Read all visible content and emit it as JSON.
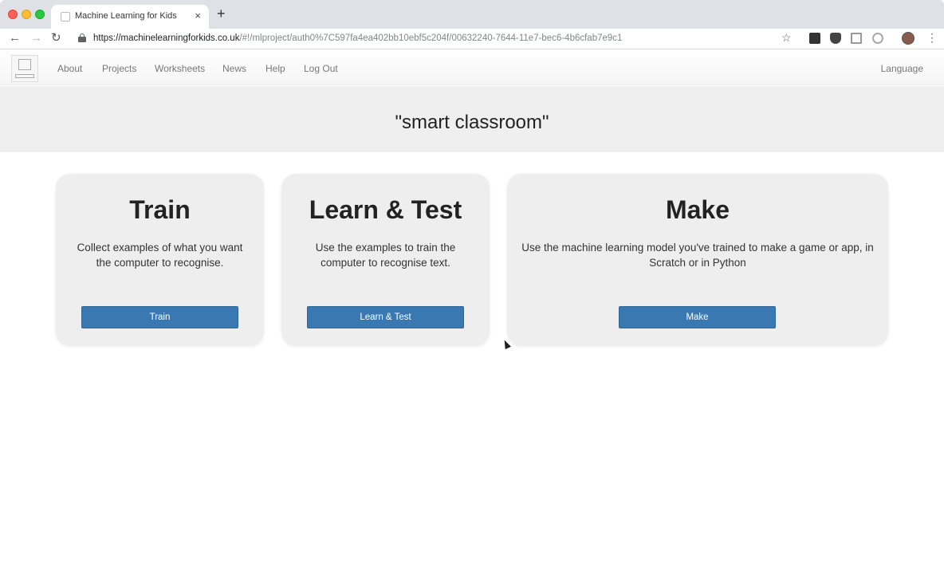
{
  "browser": {
    "tab_title": "Machine Learning for Kids",
    "url_host": "https://machinelearningforkids.co.uk",
    "url_path": "/#!/mlproject/auth0%7C597fa4ea402bb10ebf5c204f/00632240-7644-11e7-bec6-4b6cfab7e9c1",
    "new_tab_glyph": "+",
    "close_glyph": "×"
  },
  "nav": {
    "items": [
      {
        "label": "About"
      },
      {
        "label": "Projects"
      },
      {
        "label": "Worksheets"
      },
      {
        "label": "News"
      },
      {
        "label": "Help"
      },
      {
        "label": "Log Out"
      }
    ],
    "language": "Language"
  },
  "project": {
    "title": "\"smart classroom\""
  },
  "cards": [
    {
      "title": "Train",
      "description": "Collect examples of what you want the computer to recognise.",
      "button": "Train"
    },
    {
      "title": "Learn & Test",
      "description": "Use the examples to train the computer to recognise text.",
      "button": "Learn & Test"
    },
    {
      "title": "Make",
      "description": "Use the machine learning model you've trained to make a game or app, in Scratch or in Python",
      "button": "Make"
    }
  ],
  "colors": {
    "button": "#3a78b2",
    "card_bg": "#eeeeef",
    "header_band": "#efeff0"
  }
}
